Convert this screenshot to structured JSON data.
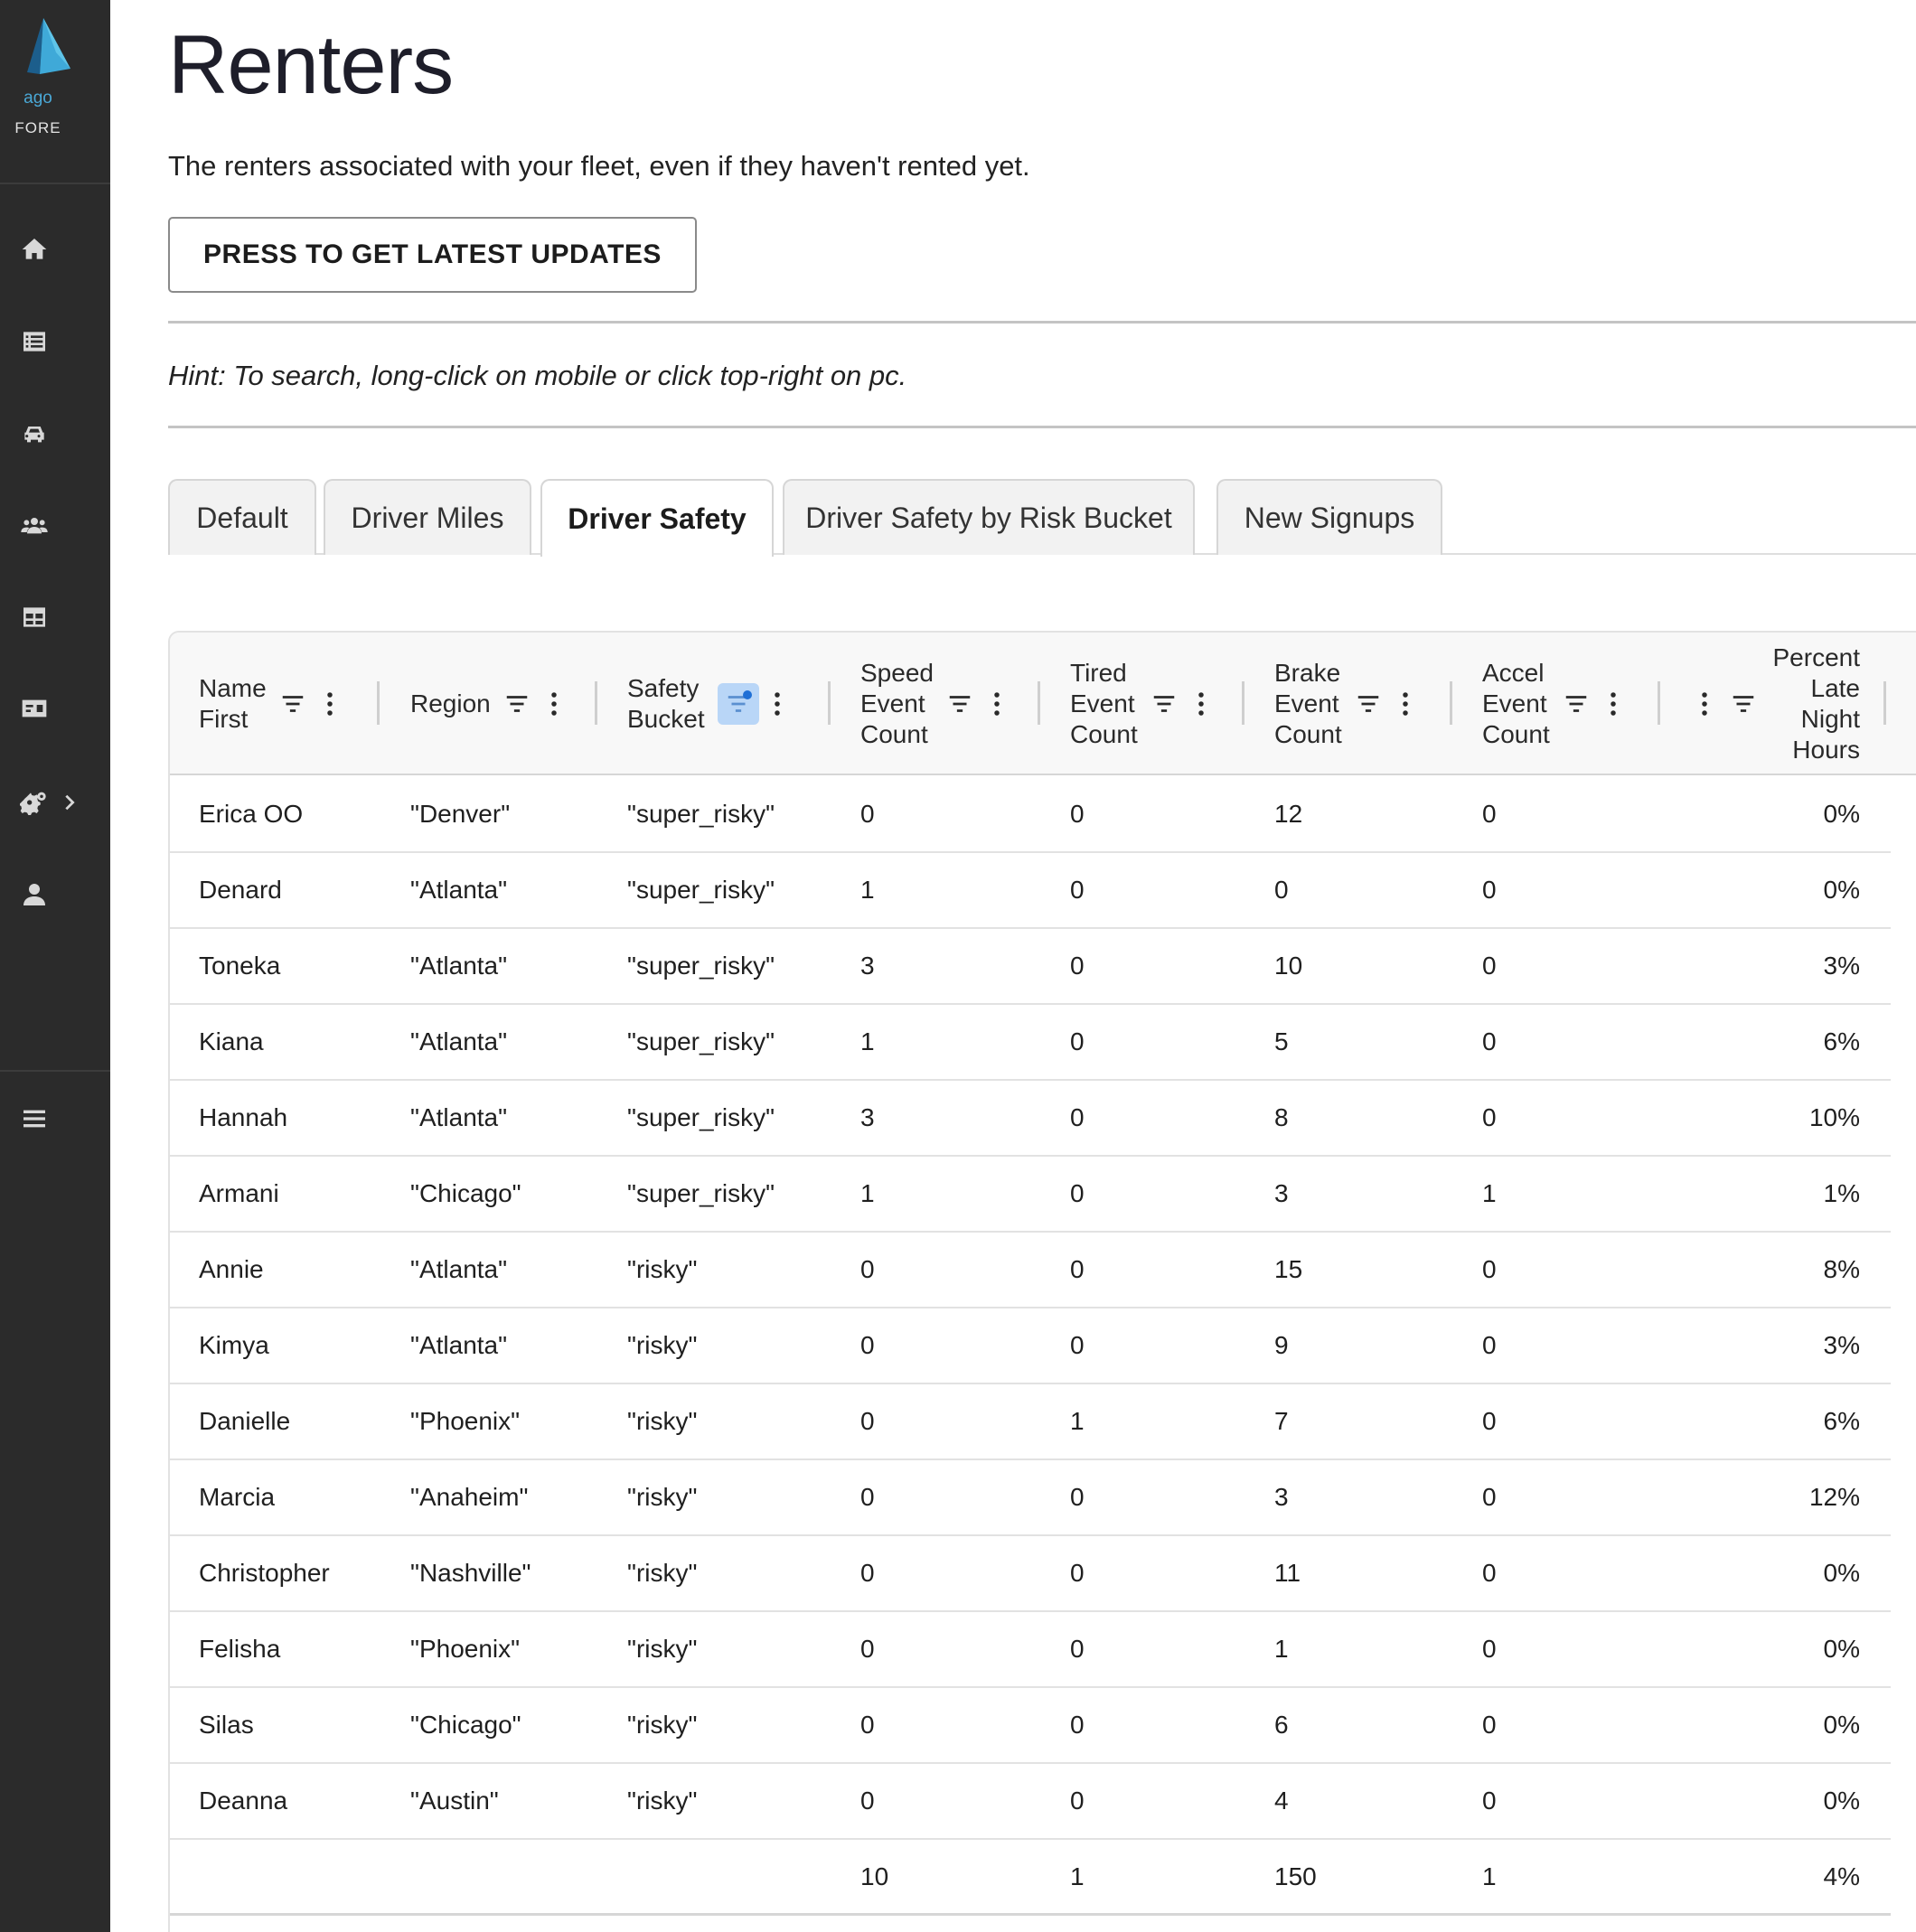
{
  "sidebar": {
    "logo_text": "ago",
    "logo_sub": "FORE",
    "nav": [
      {
        "icon": "home-icon"
      },
      {
        "icon": "list-icon"
      },
      {
        "icon": "car-icon"
      },
      {
        "icon": "users-icon"
      },
      {
        "icon": "table-icon"
      },
      {
        "icon": "id-card-icon"
      },
      {
        "icon": "settings-icon"
      },
      {
        "icon": "user-icon"
      },
      {
        "icon": "menu-icon"
      }
    ]
  },
  "page": {
    "title": "Renters",
    "subtitle": "The renters associated with your fleet, even if they haven't rented yet.",
    "update_button": "PRESS TO GET LATEST UPDATES",
    "hint": "Hint: To search, long-click on mobile or click top-right on pc."
  },
  "tabs": [
    {
      "label": "Default",
      "active": false
    },
    {
      "label": "Driver Miles",
      "active": false
    },
    {
      "label": "Driver Safety",
      "active": true
    },
    {
      "label": "Driver Safety by Risk Bucket",
      "active": false
    },
    {
      "label": "New Signups",
      "active": false
    }
  ],
  "grid": {
    "columns": [
      {
        "label": "Name\nFirst"
      },
      {
        "label": "Region"
      },
      {
        "label": "Safety\nBucket"
      },
      {
        "label": "Speed\nEvent\nCount"
      },
      {
        "label": "Tired\nEvent\nCount"
      },
      {
        "label": "Brake\nEvent\nCount"
      },
      {
        "label": "Accel\nEvent\nCount"
      },
      {
        "label": "Percent\nLate\nNight\nHours"
      }
    ],
    "rows": [
      [
        "Erica OO",
        "\"Denver\"",
        "\"super_risky\"",
        "0",
        "0",
        "12",
        "0",
        "0%"
      ],
      [
        "Denard",
        "\"Atlanta\"",
        "\"super_risky\"",
        "1",
        "0",
        "0",
        "0",
        "0%"
      ],
      [
        "Toneka",
        "\"Atlanta\"",
        "\"super_risky\"",
        "3",
        "0",
        "10",
        "0",
        "3%"
      ],
      [
        "Kiana",
        "\"Atlanta\"",
        "\"super_risky\"",
        "1",
        "0",
        "5",
        "0",
        "6%"
      ],
      [
        "Hannah",
        "\"Atlanta\"",
        "\"super_risky\"",
        "3",
        "0",
        "8",
        "0",
        "10%"
      ],
      [
        "Armani",
        "\"Chicago\"",
        "\"super_risky\"",
        "1",
        "0",
        "3",
        "1",
        "1%"
      ],
      [
        "Annie",
        "\"Atlanta\"",
        "\"risky\"",
        "0",
        "0",
        "15",
        "0",
        "8%"
      ],
      [
        "Kimya",
        "\"Atlanta\"",
        "\"risky\"",
        "0",
        "0",
        "9",
        "0",
        "3%"
      ],
      [
        "Danielle",
        "\"Phoenix\"",
        "\"risky\"",
        "0",
        "1",
        "7",
        "0",
        "6%"
      ],
      [
        "Marcia",
        "\"Anaheim\"",
        "\"risky\"",
        "0",
        "0",
        "3",
        "0",
        "12%"
      ],
      [
        "Christopher",
        "\"Nashville\"",
        "\"risky\"",
        "0",
        "0",
        "11",
        "0",
        "0%"
      ],
      [
        "Felisha",
        "\"Phoenix\"",
        "\"risky\"",
        "0",
        "0",
        "1",
        "0",
        "0%"
      ],
      [
        "Silas",
        "\"Chicago\"",
        "\"risky\"",
        "0",
        "0",
        "6",
        "0",
        "0%"
      ],
      [
        "Deanna",
        "\"Austin\"",
        "\"risky\"",
        "0",
        "0",
        "4",
        "0",
        "0%"
      ]
    ],
    "totals": [
      "",
      "",
      "",
      "10",
      "1",
      "150",
      "1",
      "4%"
    ]
  }
}
